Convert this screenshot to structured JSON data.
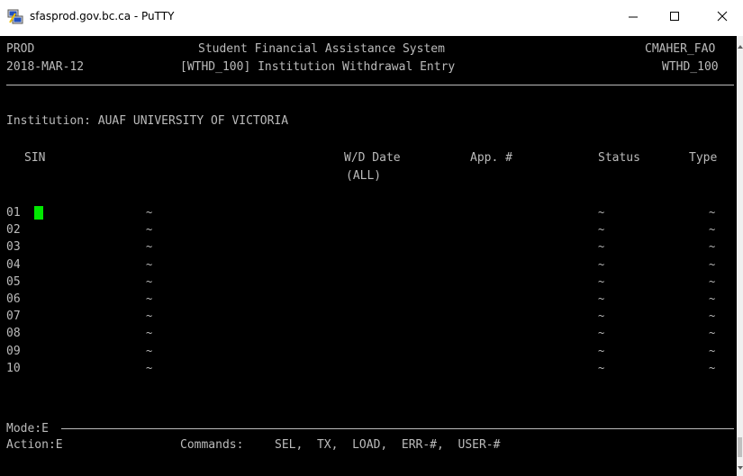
{
  "window": {
    "title": "sfasprod.gov.bc.ca - PuTTY",
    "icon": "putty-icon",
    "controls": [
      "minimize-icon",
      "maximize-icon",
      "close-icon"
    ]
  },
  "header": {
    "env": "PROD",
    "system_title": "Student Financial Assistance System",
    "user": "CMAHER_FAO",
    "date": "2018-MAR-12",
    "screen_title": "[WTHD_100] Institution Withdrawal Entry",
    "screen_id": "WTHD_100"
  },
  "institution_line": "Institution: AUAF UNIVERSITY OF VICTORIA",
  "columns": {
    "sin": "SIN",
    "wd_date": "W/D Date",
    "wd_date_sub": "(ALL)",
    "app_no": "App. #",
    "status": "Status",
    "type": "Type"
  },
  "rows": [
    "01",
    "02",
    "03",
    "04",
    "05",
    "06",
    "07",
    "08",
    "09",
    "10"
  ],
  "tilde_char": "~",
  "footer": {
    "mode": "Mode:E",
    "action": "Action:E",
    "commands_label": "Commands:",
    "commands": "SEL,  TX,  LOAD,  ERR-#,  USER-#"
  },
  "colors": {
    "terminal_bg": "#000000",
    "terminal_fg": "#bbbbbb",
    "cursor": "#00e800"
  }
}
